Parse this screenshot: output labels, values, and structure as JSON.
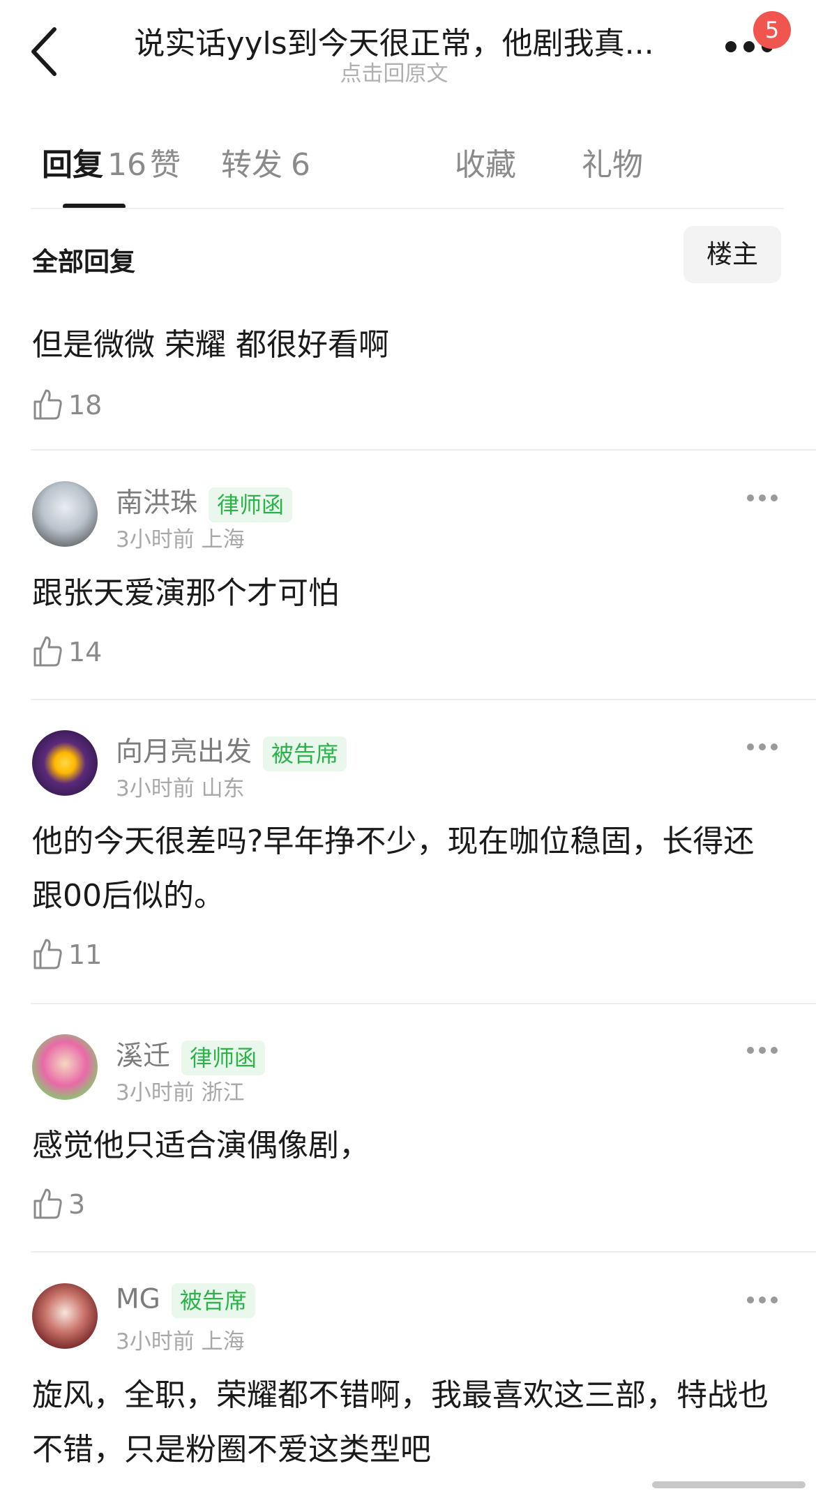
{
  "header": {
    "title": "说实话yyls到今天很正常，他剧我真...",
    "subtitle": "点击回原文",
    "notification_count": "5"
  },
  "tabs": [
    {
      "label": "回复",
      "count": "16"
    },
    {
      "label": "赞",
      "count": ""
    },
    {
      "label": "转发",
      "count": "6"
    },
    {
      "label": "收藏",
      "count": ""
    },
    {
      "label": "礼物",
      "count": ""
    }
  ],
  "section": {
    "title": "全部回复",
    "filter_label": "楼主"
  },
  "comments": [
    {
      "text": "但是微微 荣耀 都很好看啊",
      "likes": "18"
    },
    {
      "username": "南洪珠",
      "badge": "律师函",
      "meta": "3小时前 上海",
      "text": "跟张天爱演那个才可怕",
      "likes": "14"
    },
    {
      "username": "向月亮出发",
      "badge": "被告席",
      "meta": "3小时前 山东",
      "text": "他的今天很差吗?早年挣不少，现在咖位稳固，长得还跟00后似的。",
      "likes": "11"
    },
    {
      "username": "溪迁",
      "badge": "律师函",
      "meta": "3小时前 浙江",
      "text": "感觉他只适合演偶像剧，",
      "likes": "3"
    },
    {
      "username": "MG",
      "badge": "被告席",
      "meta": "3小时前 上海",
      "text": "旋风，全职，荣耀都不错啊，我最喜欢这三部，特战也不错，只是粉圈不爱这类型吧"
    }
  ]
}
